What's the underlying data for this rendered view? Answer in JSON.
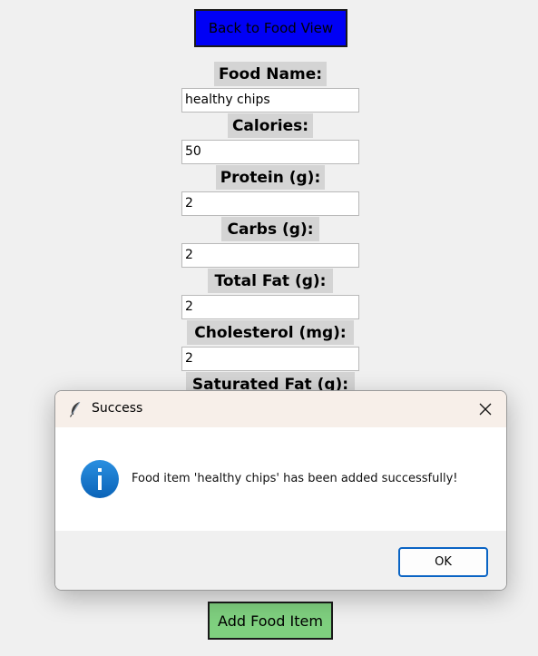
{
  "back_button": {
    "label": "Back to Food View",
    "color": "#0000f5"
  },
  "fields": [
    {
      "label": "Food Name:",
      "value": "healthy chips"
    },
    {
      "label": "Calories:",
      "value": "50"
    },
    {
      "label": "Protein (g):",
      "value": "2"
    },
    {
      "label": "Carbs (g):",
      "value": "2"
    },
    {
      "label": "Total Fat (g):",
      "value": "2"
    },
    {
      "label": "Cholesterol (mg):",
      "value": "2"
    },
    {
      "label": "Saturated Fat (g):",
      "value": ""
    }
  ],
  "add_button": {
    "label": "Add Food Item",
    "color": "#7fd07f"
  },
  "dialog": {
    "title": "Success",
    "message": "Food item 'healthy chips' has been added successfully!",
    "ok_label": "OK",
    "icon": "info-icon",
    "title_icon": "feather-icon",
    "close_icon": "close-icon"
  }
}
